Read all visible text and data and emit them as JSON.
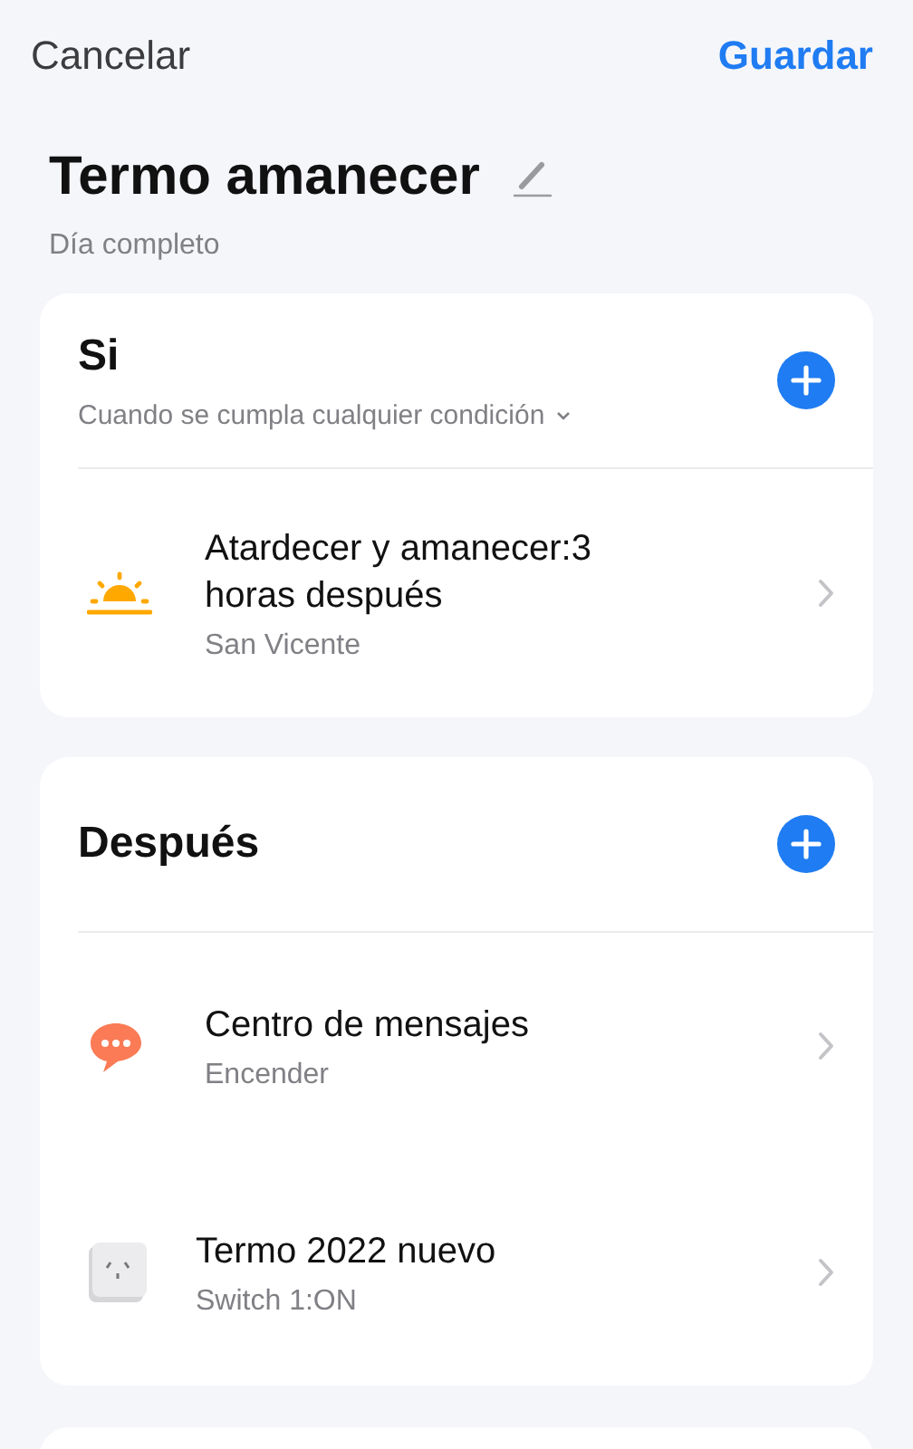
{
  "header": {
    "cancel": "Cancelar",
    "save": "Guardar"
  },
  "scene": {
    "title": "Termo amanecer",
    "subtitle": "Día completo"
  },
  "sections": [
    {
      "title": "Si",
      "condition": "Cuando se cumpla cualquier condición",
      "items": [
        {
          "kind": "sun",
          "title": "Atardecer y amanecer:3 horas después",
          "detail": "San Vicente"
        }
      ]
    },
    {
      "title": "Después",
      "items": [
        {
          "kind": "message",
          "title": "Centro de mensajes",
          "detail": "Encender"
        },
        {
          "kind": "device",
          "title": "Termo 2022 nuevo",
          "detail": "Switch 1:ON"
        }
      ]
    }
  ]
}
